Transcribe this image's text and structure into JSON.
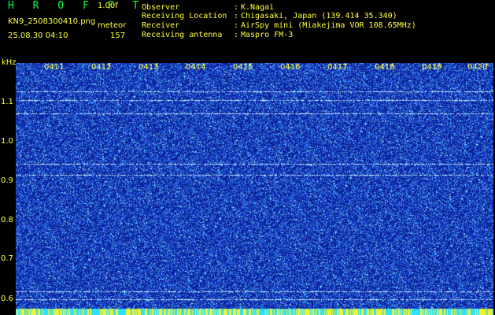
{
  "header": {
    "logo": "H R O F F T",
    "version": "1.00f",
    "filename": "KN9_2508300410.png",
    "trigger_type": "meteor",
    "timestamp": "25.08.30 04:10",
    "count": "157"
  },
  "info": [
    {
      "label": "Observer",
      "value": "K.Nagai"
    },
    {
      "label": "Receiving Location",
      "value": "Chigasaki, Japan (139.414 35.340)"
    },
    {
      "label": "Receiver",
      "value": "AirSpy mini (Miakejima VOR 108.65MHz)"
    },
    {
      "label": "Receiving antenna",
      "value": "Maspro FM-3"
    }
  ],
  "spectrogram": {
    "unit": "kHz",
    "y_ticks": [
      "1.1",
      "1.0",
      "0.9",
      "0.8",
      "0.7",
      "0.6"
    ],
    "x_ticks": [
      "0411",
      "0412",
      "0413",
      "0414",
      "0415",
      "0416",
      "0417",
      "0418",
      "0419",
      "0420"
    ],
    "colors": {
      "background": "#0a1d96",
      "noise_low": "#1f55e0",
      "noise_high": "#5fd8ff",
      "carrier": "#d8f8ff",
      "text": "#ffff3a",
      "logo": "#00ff3c"
    }
  }
}
